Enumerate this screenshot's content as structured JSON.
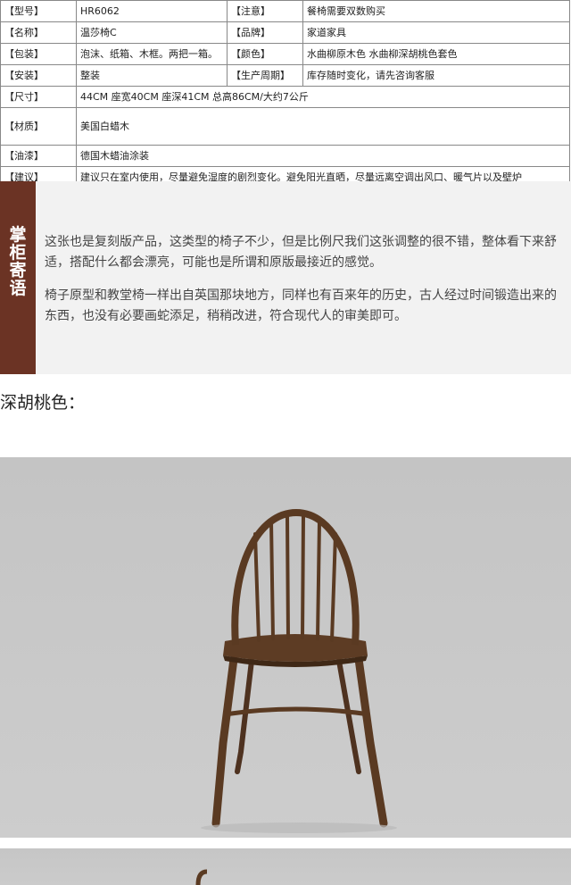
{
  "spec_rows": [
    {
      "label": "【型号】",
      "value": "HR6062",
      "label2": "【注意】",
      "value2": "餐椅需要双数购买"
    },
    {
      "label": "【名称】",
      "value": "温莎椅C",
      "label2": "【品牌】",
      "value2": "家道家具"
    },
    {
      "label": "【包装】",
      "value": "泡沫、纸箱、木框。两把一箱。",
      "label2": "【颜色】",
      "value2": "水曲柳原木色 水曲柳深胡桃色套色"
    },
    {
      "label": "【安装】",
      "value": "整装",
      "label2": "【生产周期】",
      "value2": "库存随时变化，请先咨询客服"
    },
    {
      "label": "【尺寸】",
      "value": "44CM 座宽40CM 座深41CM 总高86CM/大约7公斤"
    },
    {
      "label": "【材质】",
      "value": "美国白蜡木"
    },
    {
      "label": "【油漆】",
      "value": "德国木蜡油涂装"
    },
    {
      "label": "【建议】",
      "value": "建议只在室内使用，尽量避免湿度的剧烈变化。避免阳光直晒，尽量远离空调出风口、暖气片以及壁炉"
    }
  ],
  "note": {
    "side_title": "掌柜寄语",
    "paragraphs": [
      "这张也是复刻版产品，这类型的椅子不少，但是比例尺我们这张调整的很不错，整体看下来舒适，搭配什么都会漂亮，可能也是所谓和原版最接近的感觉。",
      "椅子原型和教堂椅一样出自英国那块地方，同样也有百来年的历史，古人经过时间锻造出来的东西，也没有必要画蛇添足，稍稍改进，符合现代人的审美即可。"
    ]
  },
  "color_label": "深胡桃色：",
  "colors": {
    "side_bar": "#6b3324",
    "wood": "#5a3a22",
    "backdrop": "#c8c8c8"
  }
}
